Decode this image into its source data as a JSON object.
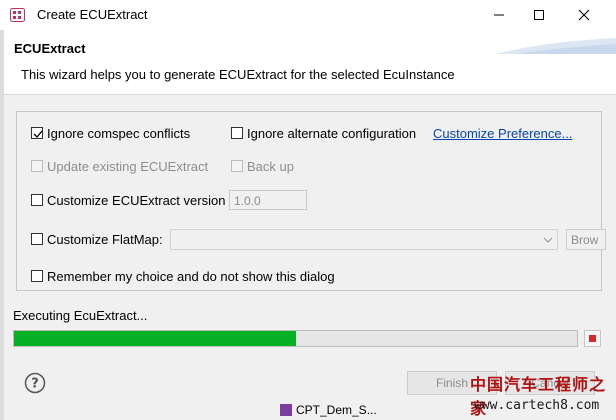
{
  "window": {
    "title": "Create ECUExtract",
    "icon": "app-icon"
  },
  "header": {
    "title": "ECUExtract",
    "description": "This wizard helps you to generate ECUExtract for the selected EcuInstance"
  },
  "options": {
    "ignore_comspec": {
      "label": "Ignore comspec conflicts",
      "checked": true,
      "enabled": true
    },
    "ignore_alternate": {
      "label": "Ignore alternate configuration",
      "checked": false,
      "enabled": true
    },
    "customize_preference_link": "Customize Preference...",
    "update_existing": {
      "label": "Update existing ECUExtract",
      "checked": false,
      "enabled": false
    },
    "back_up": {
      "label": "Back up",
      "checked": false,
      "enabled": false
    },
    "customize_version": {
      "label": "Customize ECUExtract version",
      "checked": false,
      "enabled": true
    },
    "version_value": "1.0.0",
    "customize_flatmap": {
      "label": "Customize FlatMap:",
      "checked": false,
      "enabled": true
    },
    "flatmap_value": "",
    "browse_label": "Brow",
    "remember_choice": {
      "label": "Remember my choice and do not show this dialog",
      "checked": false,
      "enabled": true
    }
  },
  "progress": {
    "status_text": "Executing EcuExtract...",
    "fraction": 0.5,
    "fill_color": "#06b025"
  },
  "footer": {
    "finish_label": "Finish",
    "cancel_label": "Cancel"
  },
  "background_app": {
    "item_label": "CPT_Dem_S..."
  },
  "watermark": {
    "chinese": "中国汽车工程师之家",
    "url": "www.cartech8.com"
  }
}
